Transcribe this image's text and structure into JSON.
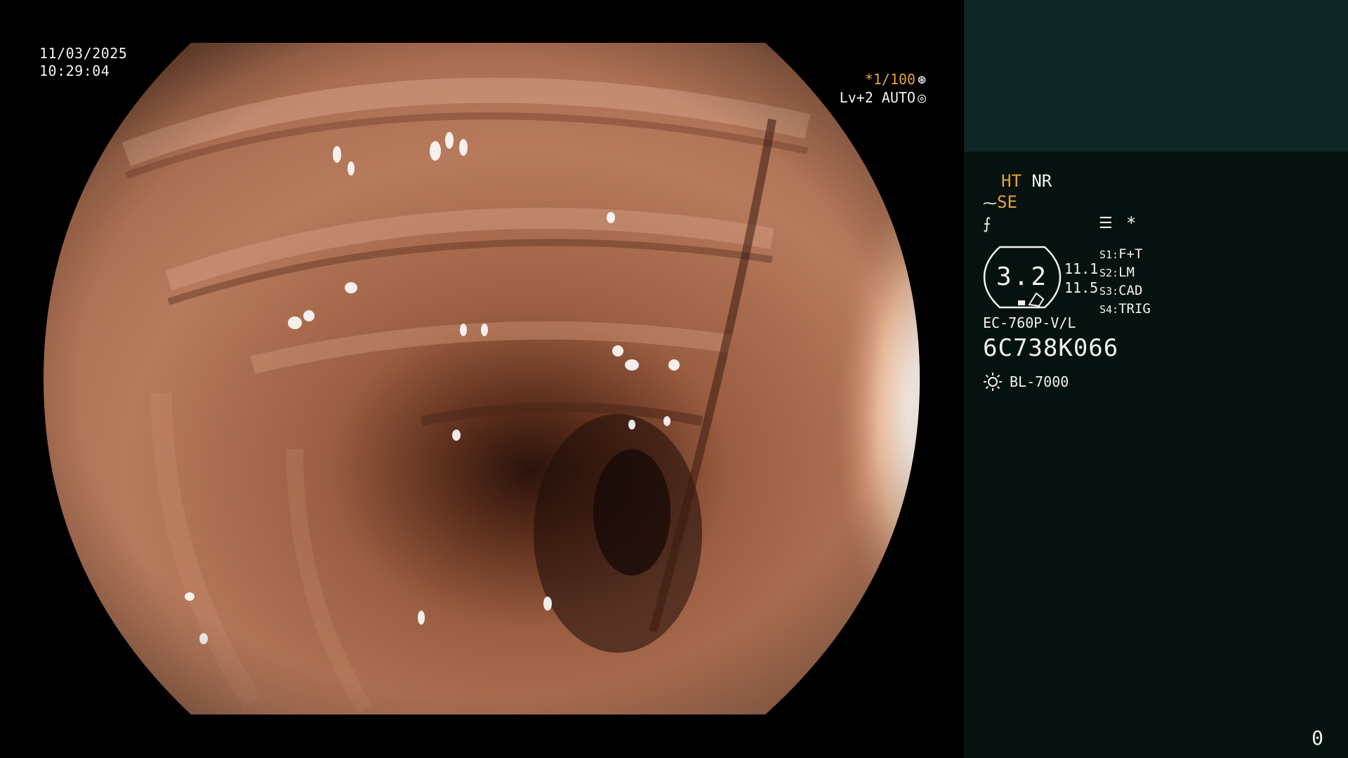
{
  "overlay": {
    "date": "11/03/2025",
    "time": "10:29:04",
    "shutter_prefix": "*1/100",
    "shutter_icon": "shutter-icon",
    "level": "Lv+2 AUTO",
    "auto_icon": "iris-icon"
  },
  "panel": {
    "ht": "HT",
    "nr": "NR",
    "se_icon": "enhance-icon",
    "se": "SE",
    "freeze_icon": "freeze-icon",
    "list_icon": "list-icon",
    "star": "*",
    "zoom_value": "3.2",
    "value_1": "11.1",
    "value_2": "11.5",
    "switches": [
      {
        "label": "S1:",
        "value": "F+T"
      },
      {
        "label": "S2:",
        "value": "LM"
      },
      {
        "label": "S3:",
        "value": "CAD"
      },
      {
        "label": "S4:",
        "value": "TRIG"
      }
    ],
    "scope_model": "EC-760P-V/L",
    "scope_serial": "6C738K066",
    "light_icon": "light-source-icon",
    "light_source": "BL-7000",
    "counter": "0"
  },
  "colors": {
    "accent_orange": "#e9a13a",
    "panel_bg": "#06120f",
    "panel_top": "#0f2724",
    "text": "#f2f2f2"
  }
}
